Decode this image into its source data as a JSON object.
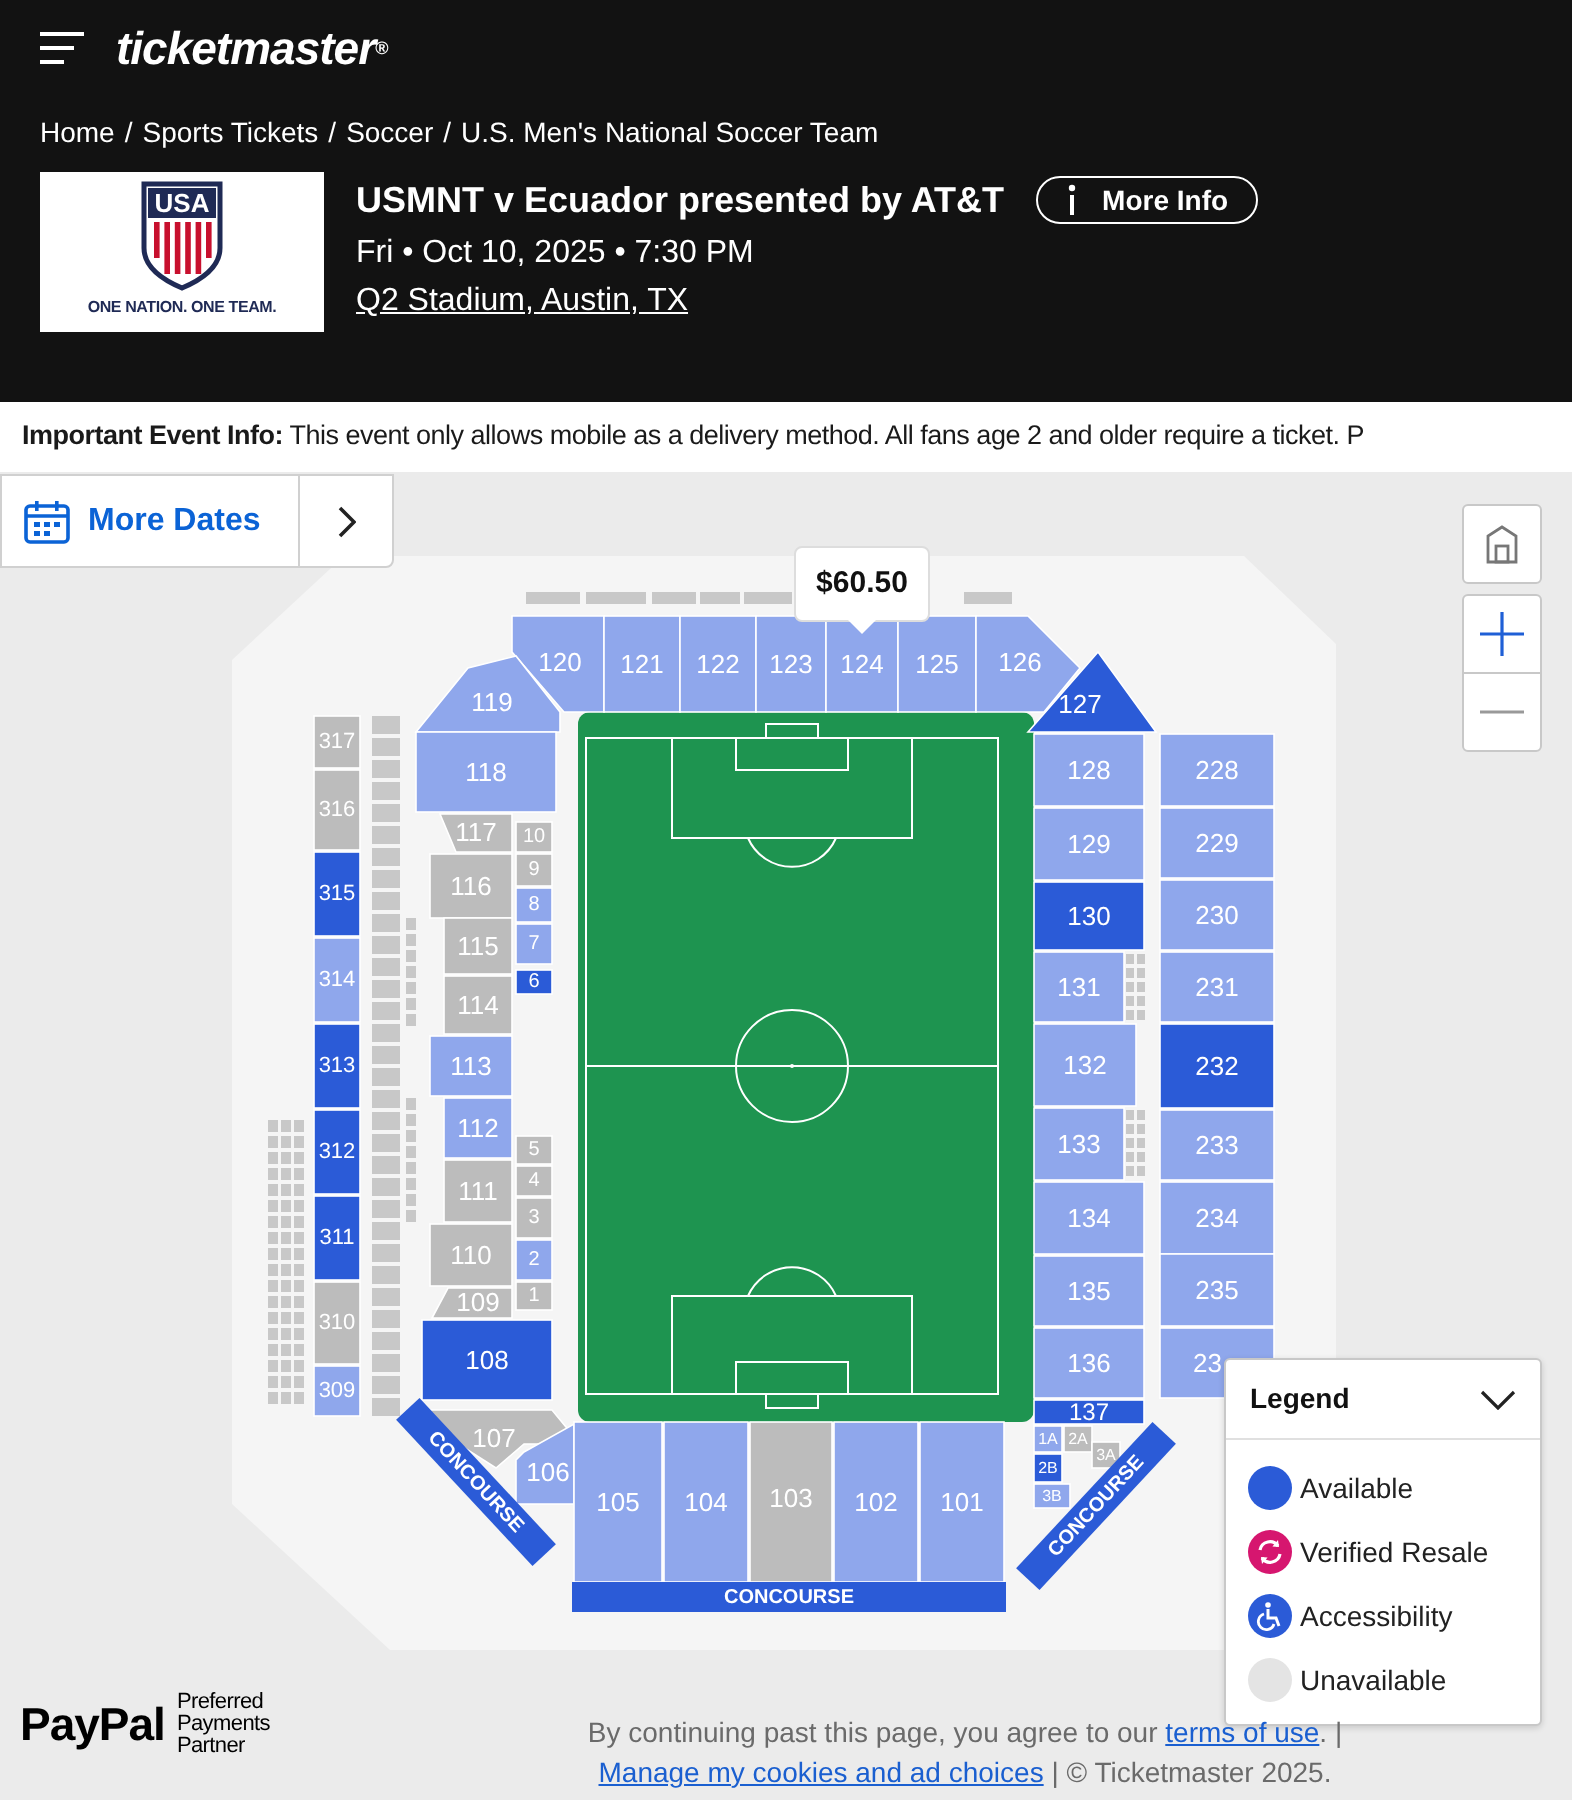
{
  "header": {
    "logo": "ticketmaster$^{®}$",
    "breadcrumb": {
      "separator": "/",
      "items": [
        "Home",
        "Sports Tickets",
        "Soccer",
        "U.S. Men's National Soccer Team"
      ]
    }
  },
  "event": {
    "team_logo": {
      "letters": "USA",
      "tagline": "ONE NATION. ONE TEAM."
    },
    "title": "USMNT v Ecuador presented by AT&T",
    "more_info": "More Info",
    "date": "Fri • Oct 10, 2025 • 7:30 PM",
    "venue": "Q2 Stadium, Austin, TX"
  },
  "notice": "**Important Event Info:** This event only allows mobile as a delivery method. All fans age 2 and older require a ticket. P",
  "more_dates": {
    "label": "More Dates"
  },
  "map": {
    "price_tooltip": "$60.50",
    "sections": [
      {
        "label": "120",
        "color": "#8fa7ec"
      },
      {
        "label": "121",
        "color": "#8fa7ec"
      },
      {
        "label": "122",
        "color": "#8fa7ec"
      },
      {
        "label": "123",
        "color": "#8fa7ec"
      },
      {
        "label": "124",
        "color": "#8fa7ec"
      },
      {
        "label": "125",
        "color": "#8fa7ec"
      },
      {
        "label": "126",
        "color": "#8fa7ec"
      },
      {
        "label": "119",
        "color": "#8fa7ec"
      },
      {
        "label": "127",
        "color": "#2b5bd7"
      },
      {
        "label": "118",
        "color": "#8fa7ec"
      },
      {
        "label": "117",
        "color": "#bcbcbc"
      },
      {
        "label": "10",
        "color": "#bcbcbc"
      },
      {
        "label": "116",
        "color": "#bcbcbc"
      },
      {
        "label": "9",
        "color": "#bcbcbc"
      },
      {
        "label": "8",
        "color": "#8fa7ec"
      },
      {
        "label": "7",
        "color": "#8fa7ec"
      },
      {
        "label": "6",
        "color": "#2b5bd7"
      },
      {
        "label": "115",
        "color": "#bcbcbc"
      },
      {
        "label": "114",
        "color": "#bcbcbc"
      },
      {
        "label": "113",
        "color": "#8fa7ec"
      },
      {
        "label": "112",
        "color": "#8fa7ec"
      },
      {
        "label": "111",
        "color": "#bcbcbc"
      },
      {
        "label": "110",
        "color": "#bcbcbc"
      },
      {
        "label": "109",
        "color": "#bcbcbc"
      },
      {
        "label": "5",
        "color": "#bcbcbc"
      },
      {
        "label": "4",
        "color": "#bcbcbc"
      },
      {
        "label": "3",
        "color": "#bcbcbc"
      },
      {
        "label": "2",
        "color": "#8fa7ec"
      },
      {
        "label": "1",
        "color": "#bcbcbc"
      },
      {
        "label": "108",
        "color": "#2b5bd7"
      },
      {
        "label": "317",
        "color": "#bcbcbc"
      },
      {
        "label": "316",
        "color": "#bcbcbc"
      },
      {
        "label": "315",
        "color": "#2b5bd7"
      },
      {
        "label": "314",
        "color": "#8fa7ec"
      },
      {
        "label": "313",
        "color": "#2b5bd7"
      },
      {
        "label": "312",
        "color": "#2b5bd7"
      },
      {
        "label": "311",
        "color": "#2b5bd7"
      },
      {
        "label": "310",
        "color": "#bcbcbc"
      },
      {
        "label": "309",
        "color": "#8fa7ec"
      },
      {
        "label": "128",
        "color": "#8fa7ec"
      },
      {
        "label": "129",
        "color": "#8fa7ec"
      },
      {
        "label": "130",
        "color": "#2b5bd7"
      },
      {
        "label": "131",
        "color": "#8fa7ec"
      },
      {
        "label": "132",
        "color": "#8fa7ec"
      },
      {
        "label": "133",
        "color": "#8fa7ec"
      },
      {
        "label": "134",
        "color": "#8fa7ec"
      },
      {
        "label": "135",
        "color": "#8fa7ec"
      },
      {
        "label": "136",
        "color": "#8fa7ec"
      },
      {
        "label": "137",
        "color": "#2b5bd7"
      },
      {
        "label": "228",
        "color": "#8fa7ec"
      },
      {
        "label": "229",
        "color": "#8fa7ec"
      },
      {
        "label": "230",
        "color": "#8fa7ec"
      },
      {
        "label": "231",
        "color": "#8fa7ec"
      },
      {
        "label": "232",
        "color": "#2b5bd7"
      },
      {
        "label": "233",
        "color": "#8fa7ec"
      },
      {
        "label": "234",
        "color": "#8fa7ec"
      },
      {
        "label": "235",
        "color": "#8fa7ec"
      },
      {
        "label": "23",
        "color": "#8fa7ec"
      },
      {
        "label": "107",
        "color": "#bcbcbc"
      },
      {
        "label": "106",
        "color": "#8fa7ec"
      },
      {
        "label": "105",
        "color": "#8fa7ec"
      },
      {
        "label": "104",
        "color": "#8fa7ec"
      },
      {
        "label": "103",
        "color": "#bcbcbc"
      },
      {
        "label": "102",
        "color": "#8fa7ec"
      },
      {
        "label": "101",
        "color": "#8fa7ec"
      },
      {
        "label": "1A",
        "color": "#8fa7ec"
      },
      {
        "label": "2A",
        "color": "#bcbcbc"
      },
      {
        "label": "3A",
        "color": "#bcbcbc"
      },
      {
        "label": "2B",
        "color": "#2b5bd7"
      },
      {
        "label": "3B",
        "color": "#8fa7ec"
      }
    ],
    "concourses": [
      "CONCOURSE",
      "CONCOURSE",
      "CONCOURSE"
    ]
  },
  "legend": {
    "title": "Legend",
    "expanded": true,
    "items": [
      {
        "kind": "available",
        "label": "Available"
      },
      {
        "kind": "resale",
        "label": "Verified Resale"
      },
      {
        "kind": "accessibility",
        "label": "Accessibility"
      },
      {
        "kind": "unavailable",
        "label": "Unavailable"
      }
    ]
  },
  "footer": {
    "paypal": {
      "brand": "PayPal",
      "tagline": "Preferred Payments Partner"
    },
    "parts": [
      {
        "kind": "text",
        "text": "By continuing past this page, you agree to our "
      },
      {
        "kind": "link",
        "text": "terms of use"
      },
      {
        "kind": "text",
        "text": ". | "
      },
      {
        "kind": "link",
        "text": "Manage my cookies and ad choices"
      },
      {
        "kind": "text",
        "text": " | © Ticketmaster 2025."
      }
    ]
  }
}
